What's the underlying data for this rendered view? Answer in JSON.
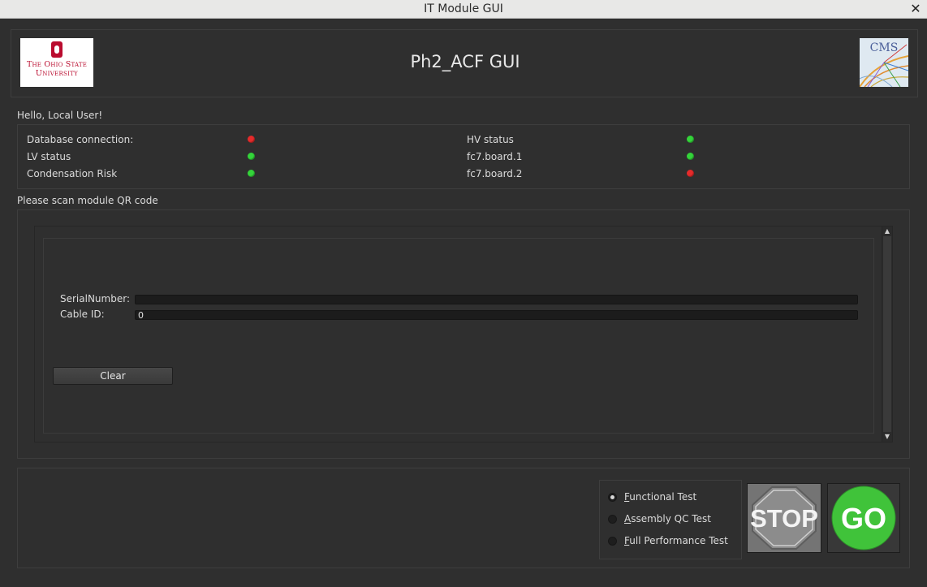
{
  "window": {
    "title": "IT Module GUI",
    "close_glyph": "✕"
  },
  "header": {
    "osu_logo": {
      "line1": "The Ohio State",
      "line2": "University"
    },
    "app_title": "Ph2_ACF GUI",
    "cms_logo_text": "CMS"
  },
  "greeting": "Hello, Local User!",
  "status": {
    "items": [
      {
        "label": "Database connection:",
        "state": "red"
      },
      {
        "label": "LV status",
        "state": "green"
      },
      {
        "label": "Condensation Risk",
        "state": "green"
      },
      {
        "label": "HV status",
        "state": "green"
      },
      {
        "label": "fc7.board.1",
        "state": "green"
      },
      {
        "label": "fc7.board.2",
        "state": "red"
      }
    ]
  },
  "scan": {
    "prompt": "Please scan module QR code",
    "serial_label": "SerialNumber:",
    "serial_value": "",
    "cable_label": "Cable ID:",
    "cable_value": "0",
    "clear_label": "Clear"
  },
  "tests": {
    "options": [
      {
        "mnemonic": "F",
        "rest": "unctional Test",
        "checked": true
      },
      {
        "mnemonic": "A",
        "rest": "ssembly QC Test",
        "checked": false
      },
      {
        "mnemonic": "F",
        "rest": "ull Performance Test",
        "checked": false
      }
    ],
    "stop_label": "STOP",
    "go_label": "GO"
  },
  "colors": {
    "led_red": "#e52b2b",
    "led_green": "#34d43a",
    "stop": "#8c8c8c",
    "go": "#40c33a"
  }
}
